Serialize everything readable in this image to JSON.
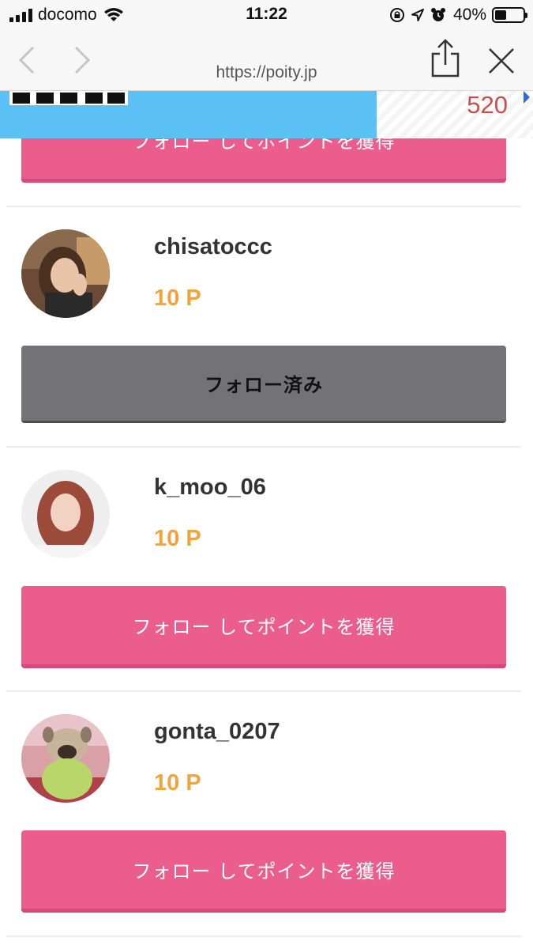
{
  "status_bar": {
    "carrier": "docomo",
    "time": "11:22",
    "battery_percent": "40%",
    "battery_level": 0.4
  },
  "browser": {
    "url": "https://poity.jp"
  },
  "banner": {
    "number": "520"
  },
  "top_button": {
    "label": "フォロー してポイントを獲得"
  },
  "users": [
    {
      "username": "chisatoccc",
      "points": "10 P",
      "button_label": "フォロー済み",
      "followed": true
    },
    {
      "username": "k_moo_06",
      "points": "10 P",
      "button_label": "フォロー してポイントを獲得",
      "followed": false
    },
    {
      "username": "gonta_0207",
      "points": "10 P",
      "button_label": "フォロー してポイントを獲得",
      "followed": false
    }
  ],
  "colors": {
    "follow_button": "#eb5d8c",
    "followed_button": "#737377",
    "points": "#f0a43a",
    "banner_blue": "#5bc1f5"
  }
}
